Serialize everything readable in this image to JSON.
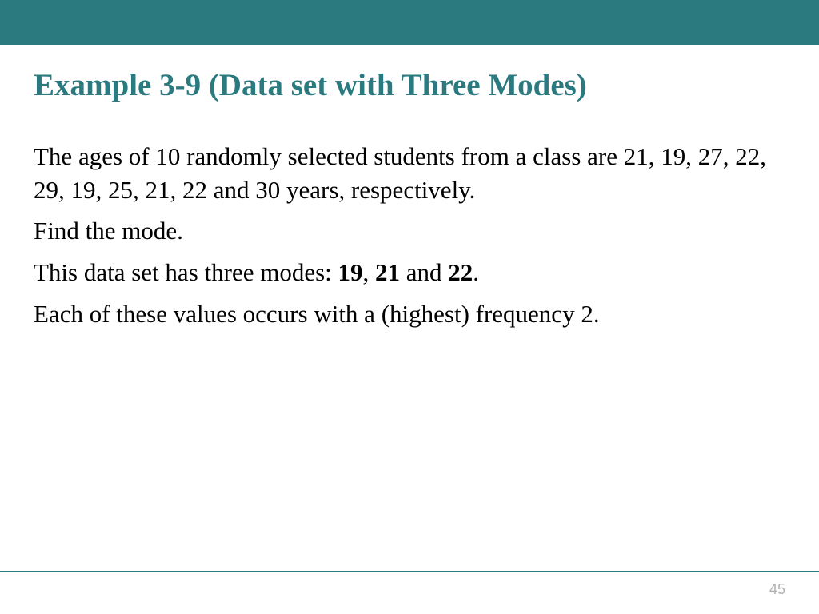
{
  "slide": {
    "title": "Example 3-9 (Data set with Three Modes)",
    "paragraph1": "The ages of 10 randomly selected students from a class are 21, 19, 27, 22, 29, 19, 25, 21, 22 and 30 years, respectively.",
    "paragraph2": "Find the mode.",
    "paragraph3_prefix": "This data set has three modes: ",
    "mode1": "19",
    "sep1": ", ",
    "mode2": "21",
    "sep2": " and ",
    "mode3": "22",
    "paragraph3_suffix": ".",
    "paragraph4": "Each of these values occurs with a (highest) frequency 2.",
    "page_number": "45"
  },
  "colors": {
    "accent": "#2a7a7f"
  }
}
